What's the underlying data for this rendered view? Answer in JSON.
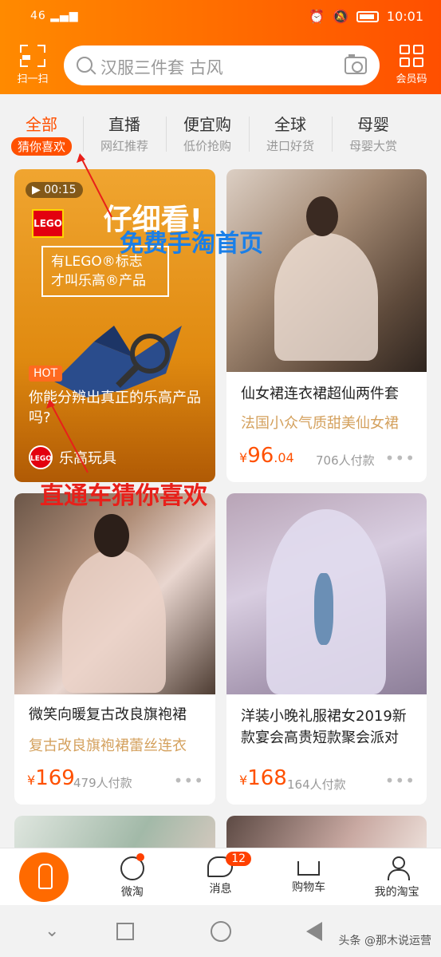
{
  "status_bar": {
    "signal": "46",
    "time": "10:01"
  },
  "header": {
    "scan_label": "扫一扫",
    "search_placeholder": "汉服三件套 古风",
    "member_label": "会员码"
  },
  "tabs": [
    {
      "title": "全部",
      "subtitle": "猜你喜欢"
    },
    {
      "title": "直播",
      "subtitle": "网红推荐"
    },
    {
      "title": "便宜购",
      "subtitle": "低价抢购"
    },
    {
      "title": "全球",
      "subtitle": "进口好货"
    },
    {
      "title": "母婴",
      "subtitle": "母婴大赏"
    }
  ],
  "ad_card": {
    "video_time": "00:15",
    "headline": "仔细看!",
    "brand_logo": "LEGO",
    "box_text": "有LEGO®标志\n才叫乐高®产品",
    "hot_label": "HOT",
    "question": "你能分辨出真正的乐高产品吗?",
    "brand_name": "乐高玩具"
  },
  "products": [
    {
      "title": "仙女裙连衣裙超仙两件套",
      "subtitle": "法国小众气质甜美仙女裙",
      "currency": "¥",
      "price": "96",
      "price_dec": ".04",
      "sold": "706人付款"
    },
    {
      "title": "微笑向暖复古改良旗袍裙",
      "subtitle": "复古改良旗袍裙蕾丝连衣",
      "currency": "¥",
      "price": "169",
      "price_dec": "",
      "sold": "479人付款"
    },
    {
      "title": "洋装小晚礼服裙女2019新款宴会高贵短款聚会派对",
      "subtitle": "",
      "currency": "¥",
      "price": "168",
      "price_dec": "",
      "sold": "164人付款"
    }
  ],
  "annotations": {
    "blue": "免费手淘首页",
    "red": "直通车猜你喜欢"
  },
  "bottom_nav": [
    {
      "label": ""
    },
    {
      "label": "微淘"
    },
    {
      "label": "消息",
      "badge": "12"
    },
    {
      "label": "购物车"
    },
    {
      "label": "我的淘宝"
    }
  ],
  "watermark": "头条 @那木说运营",
  "colors": {
    "accent": "#ff5000",
    "header": "#ff6a00",
    "subtitle_gold": "#d4a15e",
    "annotation_blue": "#1a7fe8",
    "annotation_red": "#e8201a"
  }
}
